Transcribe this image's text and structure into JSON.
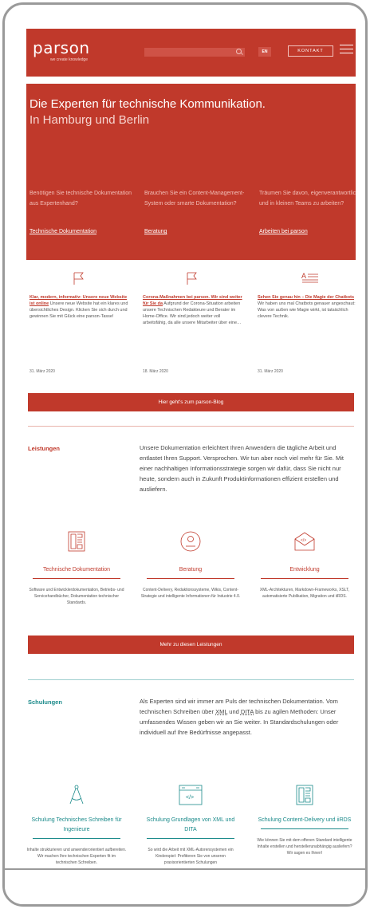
{
  "header": {
    "logo": "parson",
    "tagline": "we create knowledge",
    "lang": "EN",
    "contact": "KONTAKT"
  },
  "hero": {
    "title": "Die Experten für technische Kommunikation.",
    "subtitle": "In Hamburg und Berlin",
    "columns": [
      {
        "question": "Benötigen Sie technische Dokumentation aus Expertenhand?",
        "link": "Technische Dokumentation"
      },
      {
        "question": "Brauchen Sie ein Content-Management-System oder smarte Dokumentation?",
        "link": "Beratung"
      },
      {
        "question": "Träumen Sie davon, eigenverantwortlich und in kleinen Teams zu arbeiten?",
        "link": "Arbeiten bei parson"
      }
    ]
  },
  "news": [
    {
      "icon": "flag-icon",
      "title": "Klar, modern, informativ: Unsere neue Website ist online",
      "text": "Unsere neue Website hat ein klares und übersichtliches Design. Klicken Sie sich durch und gewinnen Sie mit Glück eine parson-Tasse!",
      "date": "31. März 2020"
    },
    {
      "icon": "flag-icon",
      "title": "Corona-Maßnahmen bei parson. Wir sind weiter für Sie da",
      "text": "Aufgrund der Corona-Situation arbeiten unsere Technischen Redakteure und Berater im Home-Office. Wir sind jedoch weiter voll arbeitsfähig, da alle unsere Mitarbeiter über eine…",
      "date": "18. März 2020"
    },
    {
      "icon": "text-align-icon",
      "title": "Sehen Sie genau hin – Die Magie der Chatbots",
      "text": "Wir haben uns mal Chatbots genauer angeschaut: Was von außen wie Magie wirkt, ist tatsächlich clevere Technik.",
      "date": "31. März 2020"
    }
  ],
  "blog_button": "Hier geht's zum parson-Blog",
  "leistungen": {
    "label": "Leistungen",
    "text": "Unsere Dokumentation erleichtert Ihren Anwendern die tägliche Arbeit und entlastet Ihren Support. Versprochen. Wir tun aber noch viel mehr für Sie. Mit einer nachhaltigen Informationsstrategie sorgen wir dafür, dass Sie nicht nur heute, sondern auch in Zukunft Produktinformationen effizient erstellen und ausliefern.",
    "items": [
      {
        "icon": "document-layout-icon",
        "title": "Technische Dokumentation",
        "desc": "Software und Entwicklerdokumentation, Betriebs- und Servicehandbücher, Dokumentation technischer Standards."
      },
      {
        "icon": "user-circle-icon",
        "title": "Beratung",
        "desc": "Content-Delivery, Redaktionssysteme, Wikis, Content-Strategie und intelligente Informationen für Industrie 4.0."
      },
      {
        "icon": "code-envelope-icon",
        "title": "Entwicklung",
        "desc": "XML-Architekturen, Markdown-Frameworks, XSLT, automatisierte Publikation, Migration und iiRDS."
      }
    ],
    "button": "Mehr zu diesen Leistungen"
  },
  "schulungen": {
    "label": "Schulungen",
    "text_pre": "Als Experten sind wir immer am Puls der technischen Dokumentation. Vom technischen Schreiben über ",
    "xml": "XML",
    "and": " und ",
    "dita": "DITA",
    "text_post": " bis zu agilen Methoden: Unser umfassendes Wissen geben wir an Sie weiter. In Standardschulungen oder individuell auf Ihre Bedürfnisse angepasst.",
    "items": [
      {
        "icon": "compass-icon",
        "title": "Schulung Technisches Schreiben für Ingenieure",
        "desc": "Inhalte strukturieren und anwenderorientiert aufbereiten. Wir machen Ihre technischen Experten fit im technischen Schreiben."
      },
      {
        "icon": "code-window-icon",
        "title": "Schulung Grundlagen von XML und DITA",
        "desc": "So wird die Arbeit mit XML-Autorensystemen ein Kinderspiel: Profitieren Sie von unseren praxisorientierten Schulungen"
      },
      {
        "icon": "document-layout-icon",
        "title": "Schulung Content-Delivery und iiRDS",
        "desc": "Wie können Sie mit dem offenen Standard intelligente Inhalte erstellen und herstellerunabhängig ausliefern? Wir sagen es Ihnen!"
      }
    ]
  },
  "colors": {
    "brand_red": "#c0392b",
    "teal": "#1a8a8a"
  }
}
